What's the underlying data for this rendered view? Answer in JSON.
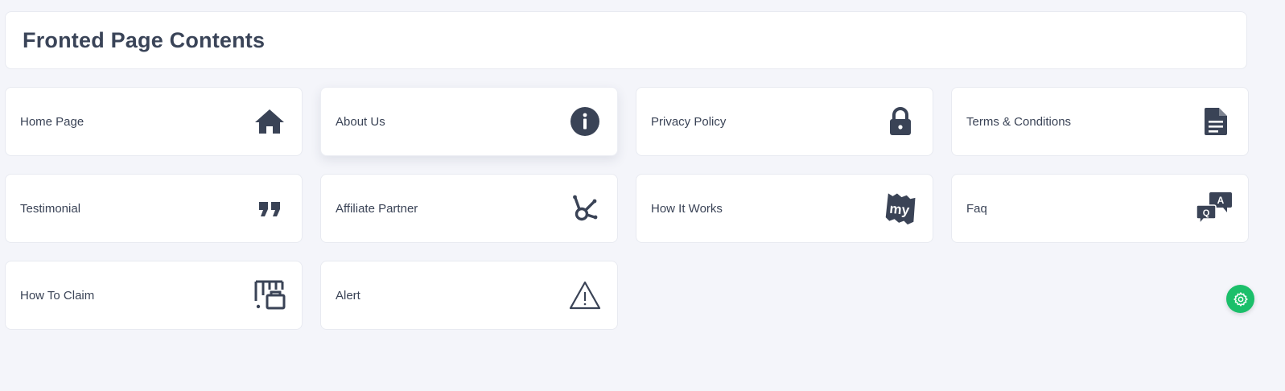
{
  "page": {
    "title": "Fronted Page Contents"
  },
  "cards": [
    {
      "label": "Home Page",
      "icon": "home-icon"
    },
    {
      "label": "About Us",
      "icon": "info-icon"
    },
    {
      "label": "Privacy Policy",
      "icon": "lock-icon"
    },
    {
      "label": "Terms & Conditions",
      "icon": "document-icon"
    },
    {
      "label": "Testimonial",
      "icon": "quote-icon"
    },
    {
      "label": "Affiliate Partner",
      "icon": "network-hub-icon"
    },
    {
      "label": "How It Works",
      "icon": "my-ticket-icon"
    },
    {
      "label": "Faq",
      "icon": "qa-chat-icon"
    },
    {
      "label": "How To Claim",
      "icon": "claim-briefcase-icon"
    },
    {
      "label": "Alert",
      "icon": "warning-triangle-icon"
    }
  ],
  "settings_button": {
    "icon": "gear-icon"
  },
  "colors": {
    "background": "#f4f5fa",
    "card": "#ffffff",
    "icon": "#3a4356",
    "accent": "#1bbf6a"
  }
}
